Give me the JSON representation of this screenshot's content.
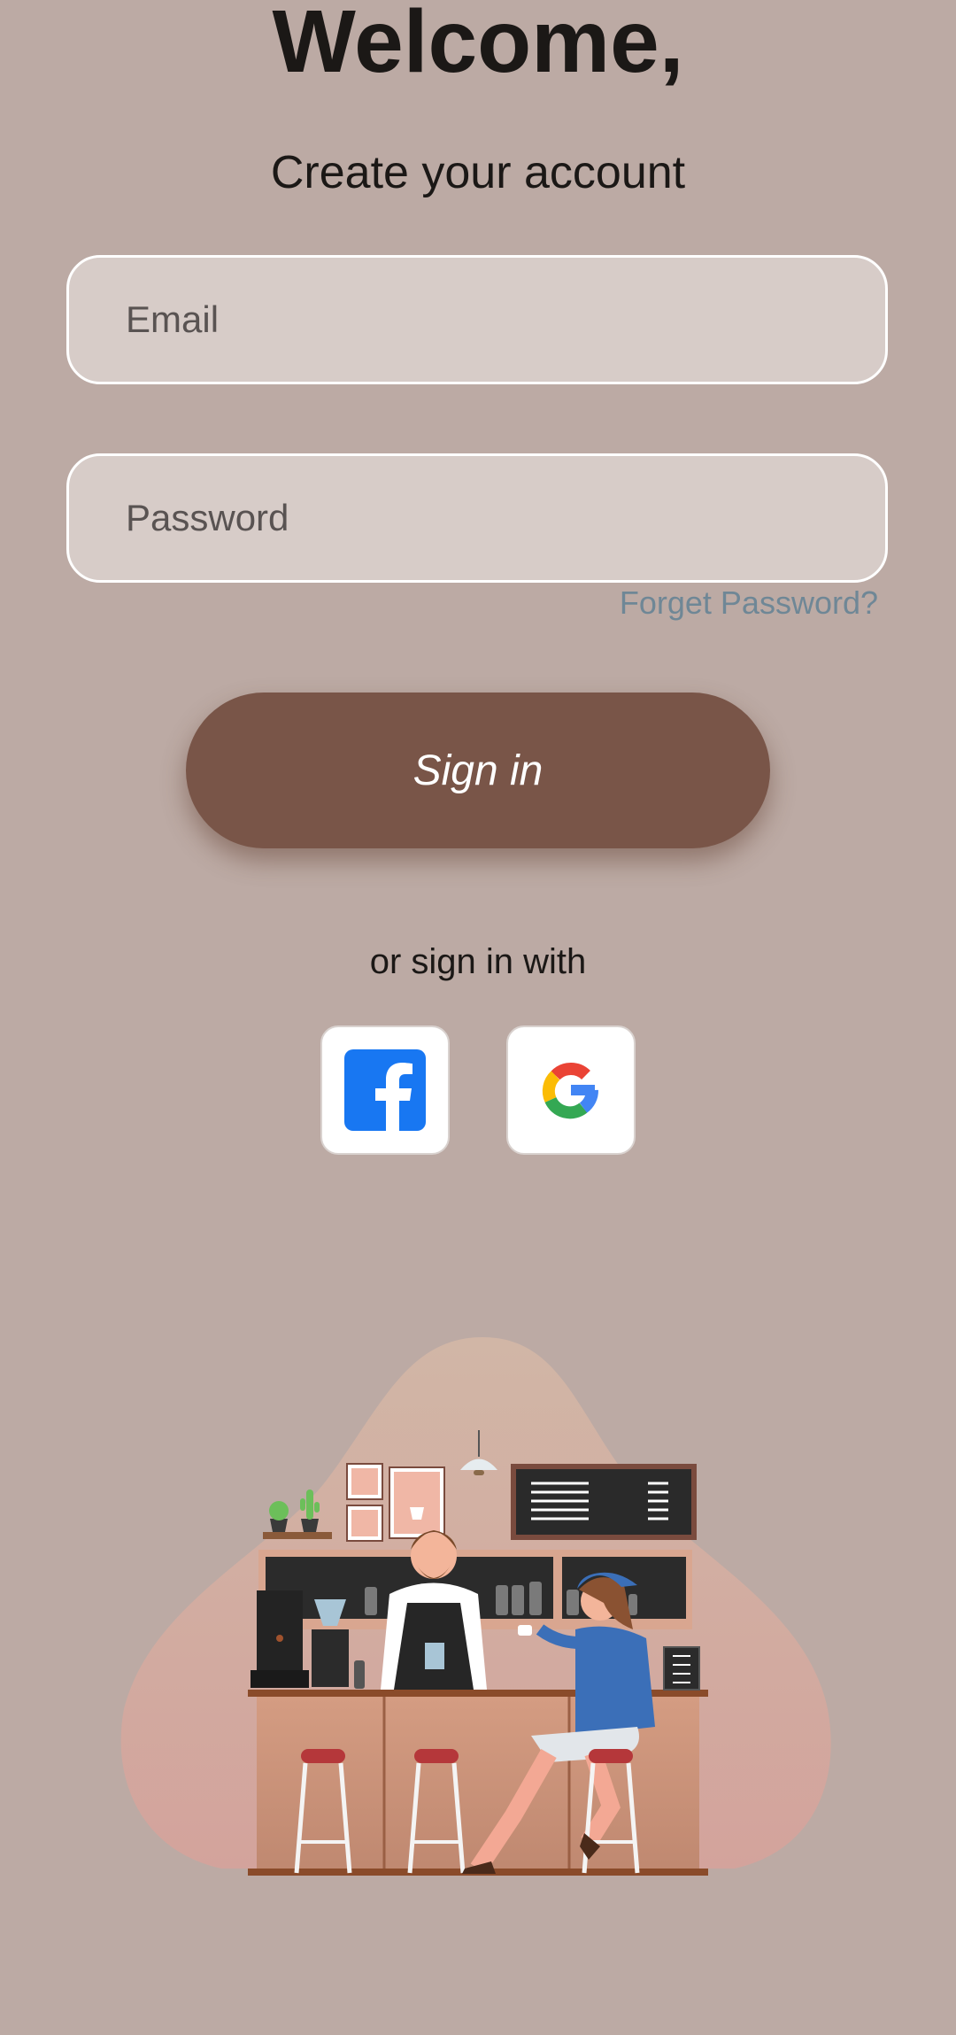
{
  "header": {
    "title": "Welcome,",
    "subtitle": "Create your account"
  },
  "form": {
    "email_placeholder": "Email",
    "password_placeholder": "Password",
    "forget_password": "Forget Password?",
    "signin_label": "Sign in"
  },
  "social": {
    "divider_text": "or sign in with",
    "providers": [
      {
        "name": "facebook",
        "icon": "facebook-icon"
      },
      {
        "name": "google",
        "icon": "google-icon"
      }
    ]
  },
  "illustration": {
    "icon": "coffee-shop-illustration"
  },
  "colors": {
    "background": "#BCAAA4",
    "field_fill": "#D7CCC8",
    "primary_button": "#795548",
    "link": "#6F8796",
    "facebook": "#1877F2"
  }
}
